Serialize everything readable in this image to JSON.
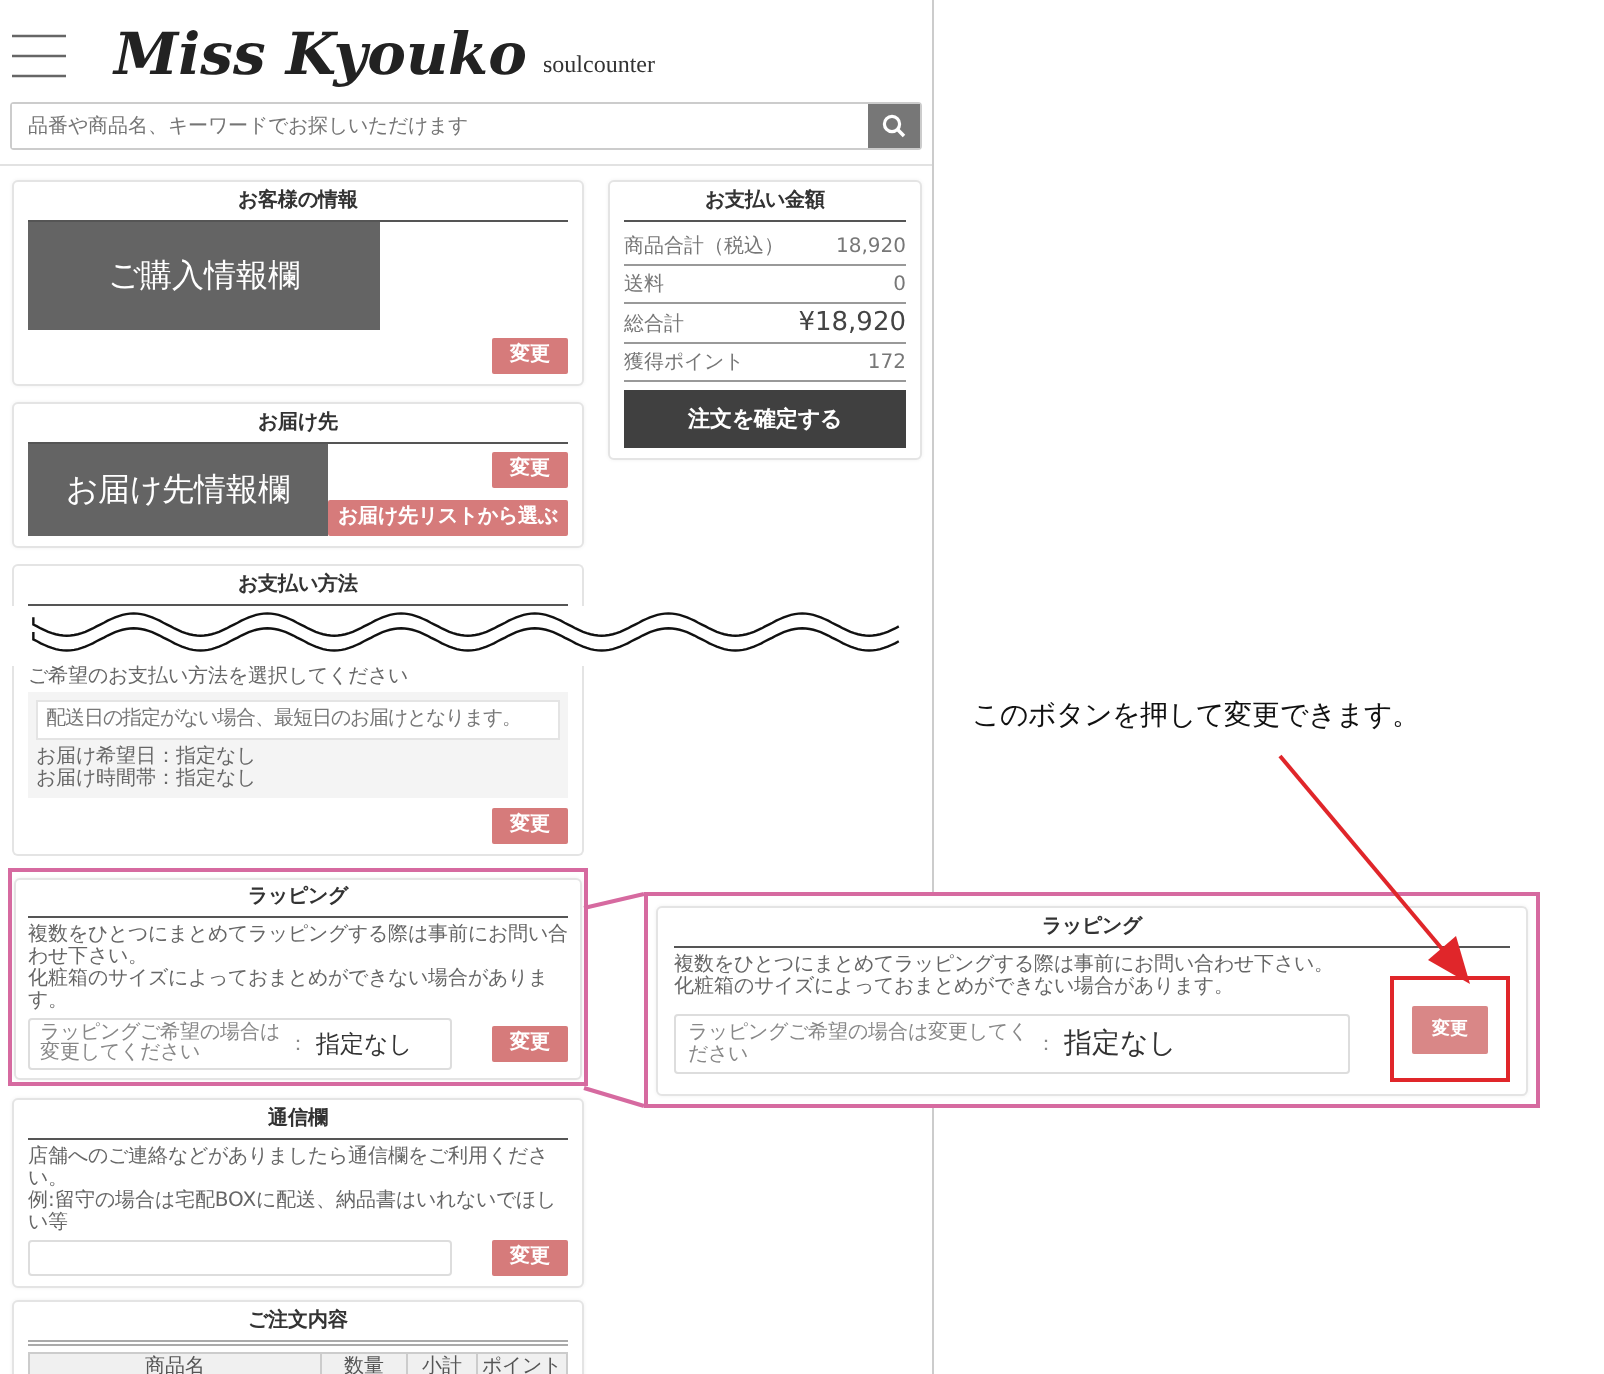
{
  "header": {
    "logo": "Miss Kyouko",
    "tagline": "soulcounter",
    "search_placeholder": "品番や商品名、キーワードでお探しいただけます"
  },
  "customer_card": {
    "title": "お客様の情報",
    "overlay_label": "ご購入情報欄",
    "button": "変更"
  },
  "payment_summary": {
    "title": "お支払い金額",
    "rows": [
      {
        "label": "商品合計（税込）",
        "value": "18,920",
        "kind": "normal"
      },
      {
        "label": "送料",
        "value": "0",
        "kind": "normal"
      },
      {
        "label": "総合計",
        "value": "¥18,920",
        "kind": "total"
      },
      {
        "label": "獲得ポイント",
        "value": "172",
        "kind": "normal"
      }
    ],
    "confirm_button": "注文を確定する"
  },
  "delivery_card": {
    "title": "お届け先",
    "overlay_label": "お届け先情報欄",
    "buttons": [
      "変更",
      "お届け先リストから選ぶ"
    ]
  },
  "payment_method_card": {
    "title": "お支払い方法",
    "instruction": "ご希望のお支払い方法を選択してください",
    "notice": "配送日の指定がない場合、最短日のお届けとなります。",
    "details": [
      "お届け希望日：指定なし",
      "お届け時間帯：指定なし"
    ],
    "button": "変更"
  },
  "wrapping_card": {
    "title": "ラッピング",
    "description": [
      "複数をひとつにまとめてラッピングする際は事前にお問い合わせ下さい。",
      "化粧箱のサイズによっておまとめができない場合があります。"
    ],
    "field_label": "ラッピングご希望の場合は変更してください",
    "separator": "：",
    "field_value": "指定なし",
    "button": "変更"
  },
  "message_card": {
    "title": "通信欄",
    "description": [
      "店舗へのご連絡などがありましたら通信欄をご利用ください。",
      "例:留守の場合は宅配BOXに配送、納品書はいれないでほしい等"
    ],
    "button": "変更"
  },
  "order_card": {
    "title": "ご注文内容",
    "columns": [
      "商品名",
      "数量",
      "小計",
      "ポイント"
    ]
  },
  "annotation": {
    "note": "このボタンを押して変更できます。",
    "callout": {
      "title": "ラッピング",
      "description": [
        "複数をひとつにまとめてラッピングする際は事前にお問い合わせ下さい。",
        "化粧箱のサイズによっておまとめができない場合があります。"
      ],
      "field_label": "ラッピングご希望の場合は変更してください",
      "separator": "：",
      "field_value": "指定なし",
      "button": "変更"
    }
  }
}
